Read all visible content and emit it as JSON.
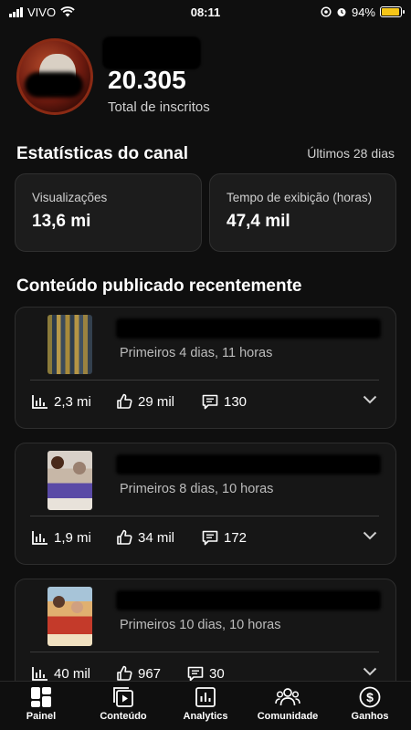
{
  "status": {
    "carrier": "VIVO",
    "time": "08:11",
    "battery": "94%",
    "battery_level": 0.94
  },
  "channel": {
    "subscribers": "20.305",
    "subscribers_label": "Total de inscritos"
  },
  "stats": {
    "title": "Estatísticas do canal",
    "period": "Últimos 28 dias",
    "views_label": "Visualizações",
    "views_value": "13,6 mi",
    "watch_label": "Tempo de exibição (horas)",
    "watch_value": "47,4 mil"
  },
  "recent": {
    "title": "Conteúdo publicado recentemente",
    "videos": [
      {
        "subtitle": "Primeiros 4 dias, 11 horas",
        "views": "2,3 mi",
        "likes": "29 mil",
        "comments": "130"
      },
      {
        "subtitle": "Primeiros 8 dias, 10 horas",
        "views": "1,9 mi",
        "likes": "34 mil",
        "comments": "172"
      },
      {
        "subtitle": "Primeiros 10 dias, 10 horas",
        "views": "40 mil",
        "likes": "967",
        "comments": "30"
      }
    ]
  },
  "nav": {
    "painel": "Painel",
    "conteudo": "Conteúdo",
    "analytics": "Analytics",
    "comunidade": "Comunidade",
    "ganhos": "Ganhos"
  },
  "icons": {
    "views": "bar-chart-icon",
    "likes": "thumbs-up-icon",
    "comments": "comment-icon",
    "expand": "chevron-down-icon",
    "accent_battery": "#f5c518"
  }
}
